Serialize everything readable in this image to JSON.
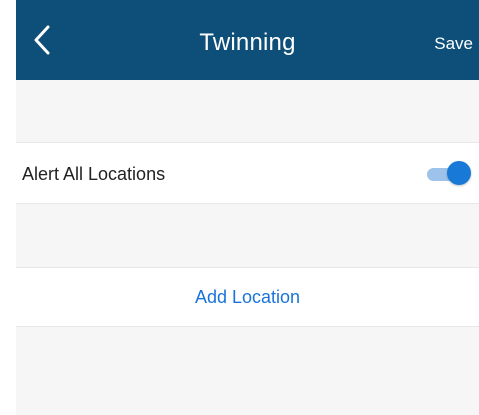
{
  "header": {
    "back_icon": "chevron-left-icon",
    "title": "Twinning",
    "save_label": "Save"
  },
  "settings": {
    "alert_all_locations": {
      "label": "Alert All Locations",
      "enabled": true
    },
    "add_location_label": "Add Location"
  },
  "colors": {
    "header_background": "#0d4f79",
    "accent_blue": "#1879d6",
    "link_blue": "#1a73d9",
    "page_background": "#f6f6f6"
  }
}
